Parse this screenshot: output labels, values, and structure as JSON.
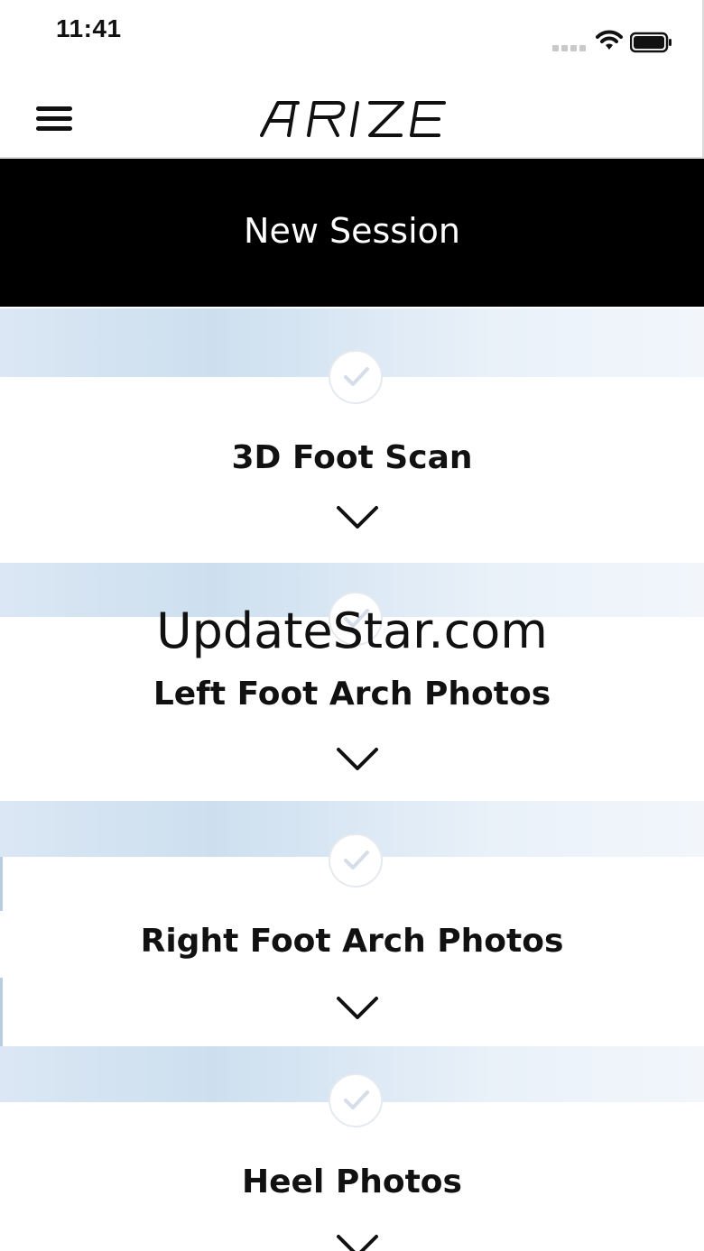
{
  "status_bar": {
    "time": "11:41"
  },
  "header": {
    "logo_text": "ARIZE"
  },
  "banner": {
    "title": "New Session"
  },
  "steps": [
    {
      "title": "3D Foot Scan"
    },
    {
      "title": "Left Foot Arch Photos"
    },
    {
      "title": "Right Foot Arch Photos"
    },
    {
      "title": "Heel Photos"
    }
  ],
  "watermark": "UpdateStar.com",
  "colors": {
    "banner_bg": "#000000",
    "band_blue": "#cddfef",
    "check_color": "#d4dde8"
  },
  "icons": [
    "menu-icon",
    "wifi-icon",
    "battery-icon",
    "check-icon",
    "chevron-down-icon"
  ]
}
